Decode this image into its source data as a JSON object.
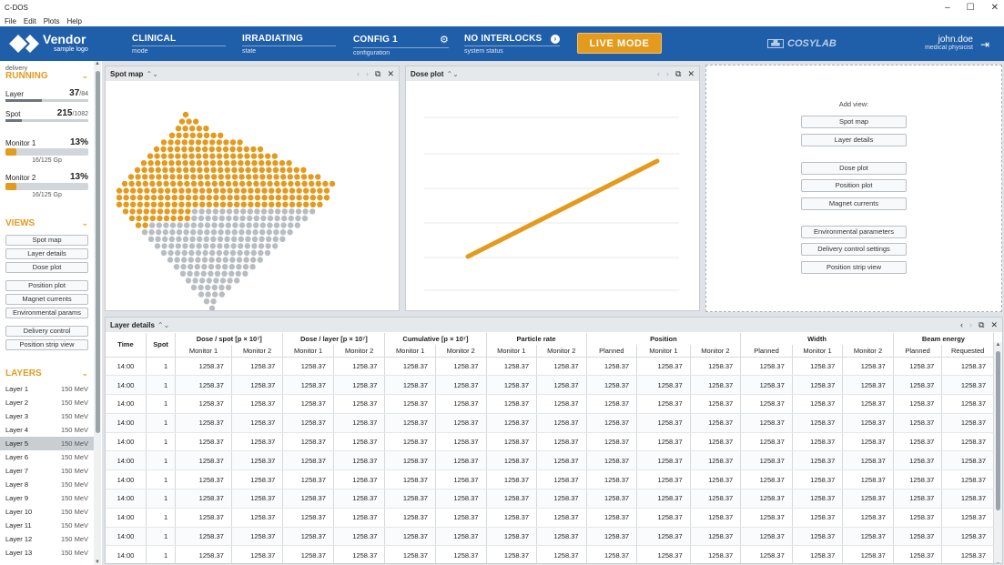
{
  "app": {
    "title": "C-DOS",
    "menu": [
      "File",
      "Edit",
      "Plots",
      "Help"
    ]
  },
  "window_controls": {
    "minimize": "–",
    "maximize": "☐",
    "close": "✕"
  },
  "header": {
    "logo_name": "Vendor",
    "logo_sub": "sample logo",
    "status": [
      {
        "value": "CLINICAL",
        "label": "mode"
      },
      {
        "value": "IRRADIATING",
        "label": "state"
      },
      {
        "value": "CONFIG 1",
        "label": "configuration"
      },
      {
        "value": "NO INTERLOCKS",
        "label": "system status"
      }
    ],
    "live_mode": "LIVE MODE",
    "brand": "COSYLAB",
    "user_name": "john.doe",
    "user_role": "medical physicist"
  },
  "sidebar": {
    "delivery_label": "delivery",
    "delivery_state": "RUNNING",
    "layer": {
      "label": "Layer",
      "value": "37",
      "total": "/84",
      "fraction": 0.44
    },
    "spot": {
      "label": "Spot",
      "value": "215",
      "total": "/1082",
      "fraction": 0.2
    },
    "monitor1": {
      "label": "Monitor 1",
      "value": "13%",
      "caption": "16/125 Gp",
      "fraction": 0.13
    },
    "monitor2": {
      "label": "Monitor 2",
      "value": "13%",
      "caption": "16/125 Gp",
      "fraction": 0.13
    },
    "views_title": "VIEWS",
    "views": [
      "Spot map",
      "Layer details",
      "Dose plot",
      "Position plot",
      "Magnet currents",
      "Environmental params",
      "Delivery control",
      "Position strip view"
    ],
    "layers_title": "LAYERS",
    "layers": [
      {
        "name": "Layer 1",
        "energy": "150 MeV"
      },
      {
        "name": "Layer 2",
        "energy": "150 MeV"
      },
      {
        "name": "Layer 3",
        "energy": "150 MeV"
      },
      {
        "name": "Layer 4",
        "energy": "150 MeV"
      },
      {
        "name": "Layer 5",
        "energy": "150 MeV"
      },
      {
        "name": "Layer 6",
        "energy": "150 MeV"
      },
      {
        "name": "Layer 7",
        "energy": "150 MeV"
      },
      {
        "name": "Layer 8",
        "energy": "150 MeV"
      },
      {
        "name": "Layer 9",
        "energy": "150 MeV"
      },
      {
        "name": "Layer 10",
        "energy": "150 MeV"
      },
      {
        "name": "Layer 11",
        "energy": "150 MeV"
      },
      {
        "name": "Layer 12",
        "energy": "150 MeV"
      },
      {
        "name": "Layer 13",
        "energy": "150 MeV"
      }
    ],
    "selected_layer": "Layer 5"
  },
  "panels": {
    "spot_map": {
      "title": "Spot map"
    },
    "dose_plot": {
      "title": "Dose plot"
    },
    "layer_details": {
      "title": "Layer details"
    }
  },
  "add_view": {
    "title": "Add view:",
    "buttons": [
      "Spot map",
      "Layer details",
      "Dose plot",
      "Position plot",
      "Magnet currents",
      "Environmental parameters",
      "Delivery control settings",
      "Position strip view"
    ]
  },
  "table": {
    "groups": [
      {
        "label": "Time",
        "subs": [
          ""
        ]
      },
      {
        "label": "Spot",
        "subs": [
          ""
        ]
      },
      {
        "label": "Dose / spot [p × 10⁷]",
        "subs": [
          "Monitor 1",
          "Monitor 2"
        ]
      },
      {
        "label": "Dose / layer [p × 10⁷]",
        "subs": [
          "Monitor 1",
          "Monitor 2"
        ]
      },
      {
        "label": "Cumulative [p × 10⁷]",
        "subs": [
          "Monitor 1",
          "Monitor 2"
        ]
      },
      {
        "label": "Particle rate",
        "subs": [
          "Monitor 1",
          "Monitor 2"
        ]
      },
      {
        "label": "Position",
        "subs": [
          "Planned",
          "Monitor 1",
          "Monitor 2"
        ]
      },
      {
        "label": "Width",
        "subs": [
          "Planned",
          "Monitor 1",
          "Monitor 2"
        ]
      },
      {
        "label": "Beam energy",
        "subs": [
          "Planned",
          "Requested"
        ]
      }
    ],
    "rows": [
      [
        "14:00",
        "1",
        "1258.37",
        "1258.37",
        "1258.37",
        "1258.37",
        "1258.37",
        "1258.37",
        "1258.37",
        "1258.37",
        "1258.37",
        "1258.37",
        "1258.37",
        "1258.37",
        "1258.37",
        "1258.37",
        "1258.37",
        "1258.37"
      ],
      [
        "14:00",
        "1",
        "1258.37",
        "1258.37",
        "1258.37",
        "1258.37",
        "1258.37",
        "1258.37",
        "1258.37",
        "1258.37",
        "1258.37",
        "1258.37",
        "1258.37",
        "1258.37",
        "1258.37",
        "1258.37",
        "1258.37",
        "1258.37"
      ],
      [
        "14:00",
        "1",
        "1258.37",
        "1258.37",
        "1258.37",
        "1258.37",
        "1258.37",
        "1258.37",
        "1258.37",
        "1258.37",
        "1258.37",
        "1258.37",
        "1258.37",
        "1258.37",
        "1258.37",
        "1258.37",
        "1258.37",
        "1258.37"
      ],
      [
        "14:00",
        "1",
        "1258.37",
        "1258.37",
        "1258.37",
        "1258.37",
        "1258.37",
        "1258.37",
        "1258.37",
        "1258.37",
        "1258.37",
        "1258.37",
        "1258.37",
        "1258.37",
        "1258.37",
        "1258.37",
        "1258.37",
        "1258.37"
      ],
      [
        "14:00",
        "1",
        "1258.37",
        "1258.37",
        "1258.37",
        "1258.37",
        "1258.37",
        "1258.37",
        "1258.37",
        "1258.37",
        "1258.37",
        "1258.37",
        "1258.37",
        "1258.37",
        "1258.37",
        "1258.37",
        "1258.37",
        "1258.37"
      ],
      [
        "14:00",
        "1",
        "1258.37",
        "1258.37",
        "1258.37",
        "1258.37",
        "1258.37",
        "1258.37",
        "1258.37",
        "1258.37",
        "1258.37",
        "1258.37",
        "1258.37",
        "1258.37",
        "1258.37",
        "1258.37",
        "1258.37",
        "1258.37"
      ],
      [
        "14:00",
        "1",
        "1258.37",
        "1258.37",
        "1258.37",
        "1258.37",
        "1258.37",
        "1258.37",
        "1258.37",
        "1258.37",
        "1258.37",
        "1258.37",
        "1258.37",
        "1258.37",
        "1258.37",
        "1258.37",
        "1258.37",
        "1258.37"
      ],
      [
        "14:00",
        "1",
        "1258.37",
        "1258.37",
        "1258.37",
        "1258.37",
        "1258.37",
        "1258.37",
        "1258.37",
        "1258.37",
        "1258.37",
        "1258.37",
        "1258.37",
        "1258.37",
        "1258.37",
        "1258.37",
        "1258.37",
        "1258.37"
      ],
      [
        "14:00",
        "1",
        "1258.37",
        "1258.37",
        "1258.37",
        "1258.37",
        "1258.37",
        "1258.37",
        "1258.37",
        "1258.37",
        "1258.37",
        "1258.37",
        "1258.37",
        "1258.37",
        "1258.37",
        "1258.37",
        "1258.37",
        "1258.37"
      ],
      [
        "14:00",
        "1",
        "1258.37",
        "1258.37",
        "1258.37",
        "1258.37",
        "1258.37",
        "1258.37",
        "1258.37",
        "1258.37",
        "1258.37",
        "1258.37",
        "1258.37",
        "1258.37",
        "1258.37",
        "1258.37",
        "1258.37",
        "1258.37"
      ],
      [
        "14:00",
        "1",
        "1258.37",
        "1258.37",
        "1258.37",
        "1258.37",
        "1258.37",
        "1258.37",
        "1258.37",
        "1258.37",
        "1258.37",
        "1258.37",
        "1258.37",
        "1258.37",
        "1258.37",
        "1258.37",
        "1258.37",
        "1258.37"
      ]
    ]
  },
  "icons": {
    "sort": "⌃⌄",
    "prev": "‹",
    "next": "›",
    "popout": "⧉",
    "close": "✕",
    "gear": "⚙",
    "arrow_right": "›",
    "chevron_down": "⌄",
    "logout": "⇥"
  },
  "colors": {
    "header": "#1f5ea8",
    "accent": "#e39a1d",
    "spot_delivered": "#e39a1d",
    "spot_pending": "#b8bdc2"
  }
}
